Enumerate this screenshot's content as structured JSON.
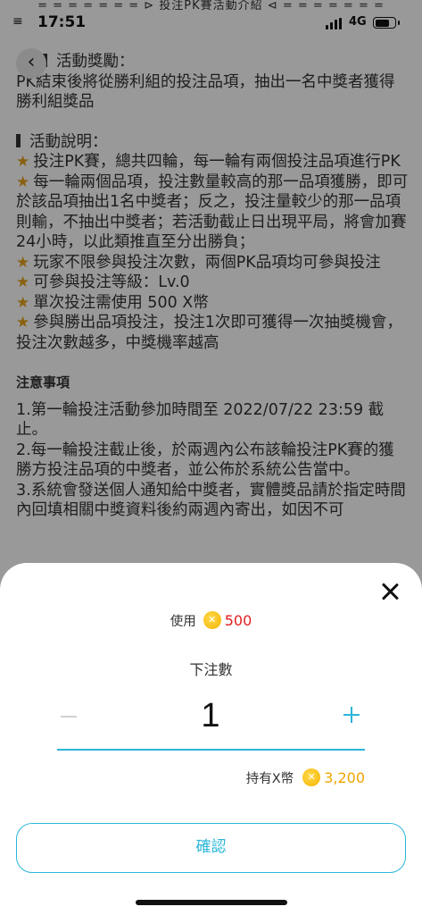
{
  "top_banner": "= = = = = = = ⊳ 投注PK賽活動介紹 ⊲ = = = = = = =",
  "status_bar": {
    "menu": "≡",
    "time": "17:51",
    "network": "4G",
    "battery_level": 0.75
  },
  "content": {
    "reward_section": {
      "title": "活動獎勵：",
      "text": "PK結束後將從勝利組的投注品項，抽出一名中獎者獲得勝利組獎品"
    },
    "rules_section": {
      "title": "活動說明：",
      "items": [
        "投注PK賽，總共四輪，每一輪有兩個投注品項進行PK",
        "每一輪兩個品項，投注數量較高的那一品項獲勝，即可於該品項抽出1名中獎者；反之，投注量較少的那一品項則輸，不抽出中獎者；若活動截止日出現平局，將會加賽24小時，以此類推直至分出勝負；",
        "玩家不限參與投注次數，兩個PK品項均可參與投注",
        "可參與投注等級：Lv.0",
        "單次投注需使用 500 X幣",
        "參與勝出品項投注，投注1次即可獲得一次抽獎機會，投注次數越多，中獎機率越高"
      ]
    },
    "notice": {
      "title": "注意事項",
      "items": [
        "1.第一輪投注活動參加時間至 2022/07/22 23:59 截止。",
        "2.每一輪投注截止後，於兩週內公布該輪投注PK賽的獲勝方投注品項的中獎者，並公佈於系統公告當中。",
        "3.系統會發送個人通知給中獎者，實體獎品請於指定時間內回填相關中獎資料後約兩週內寄出，如因不可"
      ]
    }
  },
  "sheet": {
    "cost_label": "使用",
    "cost_amount": "500",
    "quantity_title": "下注數",
    "quantity_value": "1",
    "balance_label": "持有X幣",
    "balance_amount": "3,200",
    "confirm_label": "確認"
  },
  "icons": {
    "back": "chevron-left-icon",
    "close": "close-icon",
    "coin": "x-coin-icon",
    "star": "star-icon"
  },
  "colors": {
    "accent": "#2ab6d9",
    "cost": "#e02020",
    "balance": "#f0a500",
    "coin": "#f5b400"
  }
}
